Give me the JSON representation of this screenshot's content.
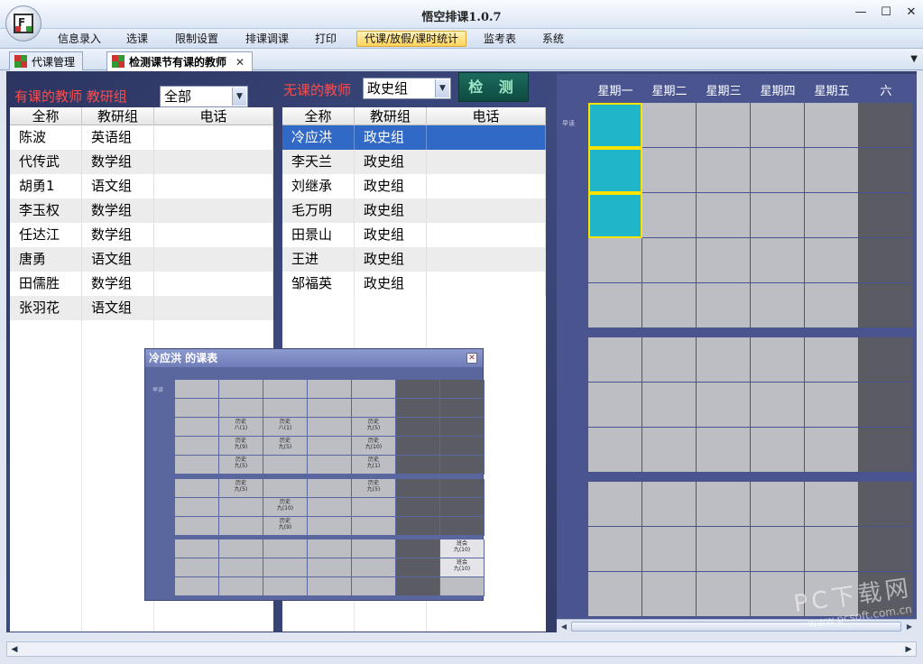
{
  "app": {
    "title": "悟空排课1.0.7",
    "logo_letter": "F"
  },
  "menu": [
    "信息录入",
    "选课",
    "限制设置",
    "排课调课",
    "打印",
    "代课/放假/课时统计",
    "监考表",
    "系统"
  ],
  "menu_active_index": 5,
  "tabs": [
    {
      "label": "代课管理",
      "active": false
    },
    {
      "label": "检测课节有课的教师",
      "active": true
    }
  ],
  "left_panel": {
    "title": "有课的教师 教研组",
    "filter_value": "全部",
    "columns": [
      "全称",
      "教研组",
      "电话"
    ],
    "rows": [
      [
        "陈波",
        "英语组",
        ""
      ],
      [
        "代传武",
        "数学组",
        ""
      ],
      [
        "胡勇1",
        "语文组",
        ""
      ],
      [
        "李玉权",
        "数学组",
        ""
      ],
      [
        "任达江",
        "数学组",
        ""
      ],
      [
        "唐勇",
        "语文组",
        ""
      ],
      [
        "田儒胜",
        "数学组",
        ""
      ],
      [
        "张羽花",
        "语文组",
        ""
      ]
    ]
  },
  "middle_panel": {
    "title": "无课的教师",
    "filter_value": "政史组",
    "check_button": "检 测",
    "columns": [
      "全称",
      "教研组",
      "电话"
    ],
    "selected_index": 0,
    "rows": [
      [
        "冷应洪",
        "政史组",
        ""
      ],
      [
        "李天兰",
        "政史组",
        ""
      ],
      [
        "刘继承",
        "政史组",
        ""
      ],
      [
        "毛万明",
        "政史组",
        ""
      ],
      [
        "田景山",
        "政史组",
        ""
      ],
      [
        "王进",
        "政史组",
        ""
      ],
      [
        "邹福英",
        "政史组",
        ""
      ]
    ]
  },
  "schedule": {
    "days": [
      "星期一",
      "星期二",
      "星期三",
      "星期四",
      "星期五",
      "六"
    ],
    "morning_label": "早读"
  },
  "popup": {
    "title": "冷应洪 的课表",
    "close": "✕",
    "morning_label": "早读",
    "entries": [
      {
        "text": "历史\n八(1)"
      },
      {
        "text": "历史\n八(1)"
      },
      {
        "text": "历史\n九(5)"
      },
      {
        "text": "历史\n九(9)"
      },
      {
        "text": "历史\n九(5)"
      },
      {
        "text": "历史\n九(10)"
      },
      {
        "text": "历史\n九(5)"
      },
      {
        "text": "历史\n九(1)"
      },
      {
        "text": "历史\n九(5)"
      },
      {
        "text": "历史\n九(5)"
      },
      {
        "text": "历史\n九(10)"
      },
      {
        "text": "历史\n九(9)"
      },
      {
        "text": "班会\n九(10)"
      },
      {
        "text": "班会\n九(10)"
      }
    ]
  },
  "watermark": {
    "main": "PC下载网",
    "sub": "www.pcsoft.com.cn"
  }
}
